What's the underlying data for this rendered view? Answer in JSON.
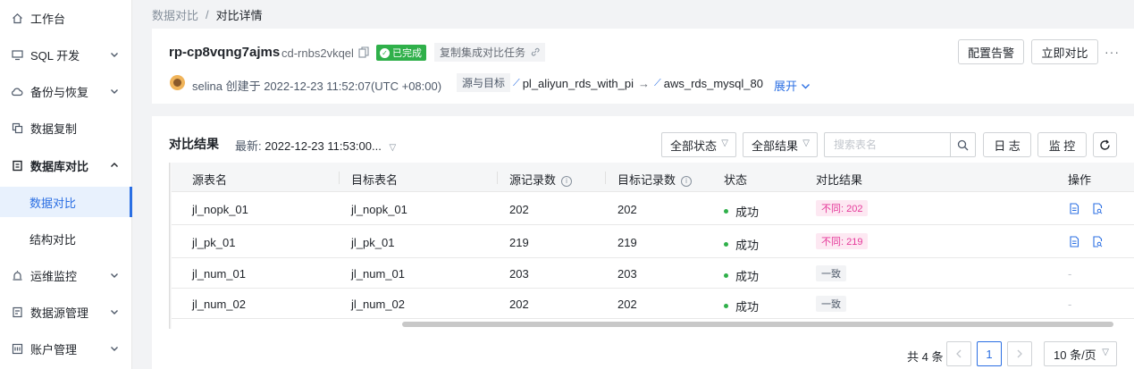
{
  "sidebar": {
    "items": [
      {
        "label": "工作台",
        "icon": "home-icon",
        "has_children": false
      },
      {
        "label": "SQL 开发",
        "icon": "monitor-icon",
        "has_children": true
      },
      {
        "label": "备份与恢复",
        "icon": "cloud-icon",
        "has_children": true
      },
      {
        "label": "数据复制",
        "icon": "copy-icon",
        "has_children": false
      },
      {
        "label": "数据库对比",
        "icon": "compare-icon",
        "has_children": true,
        "expanded": true
      },
      {
        "label": "数据对比",
        "sub": true,
        "active": true
      },
      {
        "label": "结构对比",
        "sub": true
      },
      {
        "label": "运维监控",
        "icon": "alarm-icon",
        "has_children": true
      },
      {
        "label": "数据源管理",
        "icon": "datasource-icon",
        "has_children": true
      },
      {
        "label": "账户管理",
        "icon": "account-icon",
        "has_children": true
      }
    ]
  },
  "breadcrumb": {
    "parent": "数据对比",
    "separator": "/",
    "current": "对比详情"
  },
  "task": {
    "name": "rp-cp8vqng7ajms",
    "id": "cd-rnbs2vkqel",
    "status": "已完成",
    "status_color": "#2fb04a",
    "type": "复制集成对比任务",
    "creator_line": "selina 创建于 2022-12-23 11:52:07(UTC +08:00)",
    "source_target_label": "源与目标",
    "source": "pl_aliyun_rds_with_pi",
    "target": "aws_rds_mysql_80",
    "expand_label": "展开"
  },
  "actions": {
    "alert_label": "配置告警",
    "compare_label": "立即对比",
    "more_label": "···"
  },
  "results": {
    "title": "对比结果",
    "latest_label": "最新:",
    "latest_value": "2022-12-23 11:53:00...",
    "status_filter": "全部状态",
    "result_filter": "全部结果",
    "search_placeholder": "搜索表名",
    "log_label": "日 志",
    "monitor_label": "监 控",
    "columns": [
      "源表名",
      "目标表名",
      "源记录数",
      "目标记录数",
      "状态",
      "对比结果",
      "操作"
    ],
    "rows": [
      {
        "src": "jl_nopk_01",
        "dst": "jl_nopk_01",
        "src_count": "202",
        "dst_count": "202",
        "status": "成功",
        "result": "不同: 202",
        "result_type": "diff",
        "op": "icons"
      },
      {
        "src": "jl_pk_01",
        "dst": "jl_pk_01",
        "src_count": "219",
        "dst_count": "219",
        "status": "成功",
        "result": "不同: 219",
        "result_type": "diff",
        "op": "icons"
      },
      {
        "src": "jl_num_01",
        "dst": "jl_num_01",
        "src_count": "203",
        "dst_count": "203",
        "status": "成功",
        "result": "一致",
        "result_type": "same",
        "op": "-"
      },
      {
        "src": "jl_num_02",
        "dst": "jl_num_02",
        "src_count": "202",
        "dst_count": "202",
        "status": "成功",
        "result": "一致",
        "result_type": "same",
        "op": "-"
      }
    ]
  },
  "pagination": {
    "total_text": "共 4 条",
    "current_page": "1",
    "page_size": "10 条/页"
  },
  "colors": {
    "accent": "#2b6fe3",
    "success": "#2fb04a",
    "diff_text": "#e5399a",
    "diff_bg": "#fde8f2"
  }
}
